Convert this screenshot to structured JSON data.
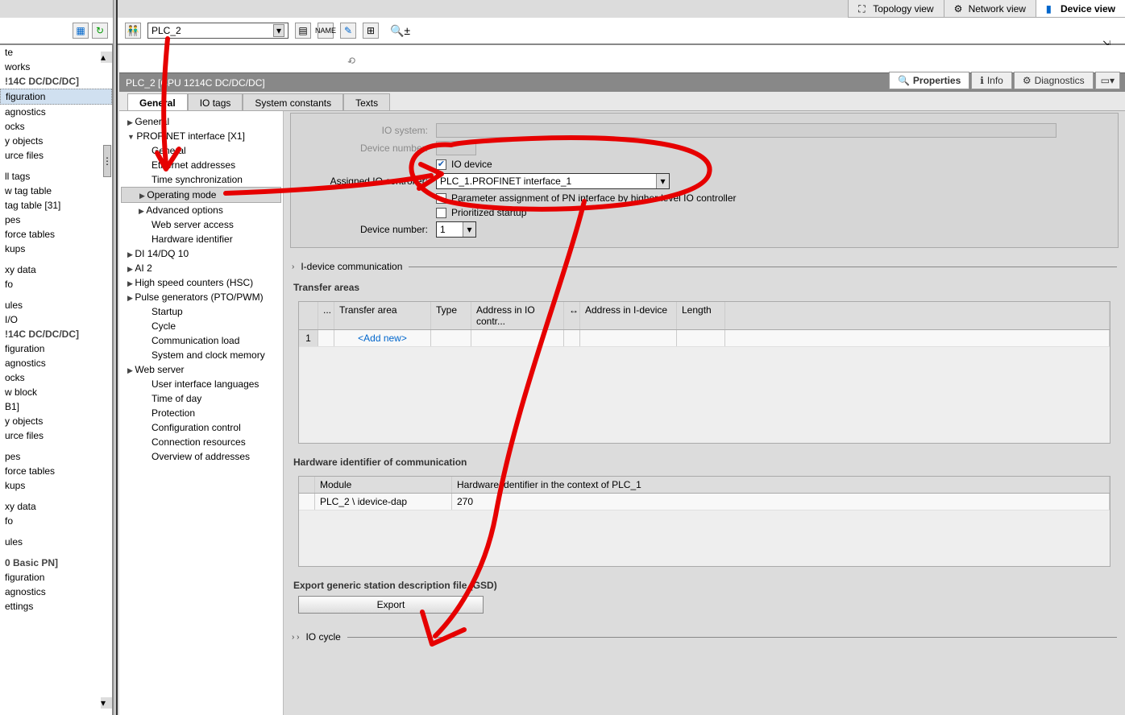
{
  "top_tabs": {
    "topology": "Topology view",
    "network": "Network view",
    "device": "Device view"
  },
  "toolbar": {
    "device_selected": "PLC_2"
  },
  "titlebar": "PLC_2 [CPU 1214C DC/DC/DC]",
  "info_tabs": {
    "properties": "Properties",
    "info": "Info",
    "diagnostics": "Diagnostics"
  },
  "prop_tabs": {
    "general": "General",
    "io_tags": "IO tags",
    "sysconst": "System constants",
    "texts": "Texts"
  },
  "left_items": [
    "te",
    "works",
    "!14C DC/DC/DC]",
    "figuration",
    "agnostics",
    "ocks",
    "y objects",
    "urce files",
    "",
    "ll tags",
    "w tag table",
    "tag table [31]",
    "pes",
    "force tables",
    "kups",
    "",
    "xy data",
    "fo",
    "",
    "ules",
    "I/O",
    "!14C DC/DC/DC]",
    "figuration",
    "agnostics",
    "ocks",
    "w block",
    "B1]",
    "y objects",
    "urce files",
    "",
    "pes",
    "force tables",
    "kups",
    "",
    "xy data",
    "fo",
    "",
    "ules",
    "",
    "0 Basic PN]",
    "figuration",
    "agnostics",
    "ettings"
  ],
  "left_selected_index": 3,
  "left_bold_heads": [
    2,
    21,
    39
  ],
  "tree": [
    {
      "l": 1,
      "t": "General",
      "open": false
    },
    {
      "l": 1,
      "t": "PROFINET interface [X1]",
      "open": true
    },
    {
      "l": 3,
      "t": "General"
    },
    {
      "l": 3,
      "t": "Ethernet addresses"
    },
    {
      "l": 3,
      "t": "Time synchronization"
    },
    {
      "l": 2,
      "t": "Operating mode",
      "sel": true,
      "exp": true
    },
    {
      "l": 2,
      "t": "Advanced options",
      "exp": true
    },
    {
      "l": 3,
      "t": "Web server access"
    },
    {
      "l": 3,
      "t": "Hardware identifier"
    },
    {
      "l": 1,
      "t": "DI 14/DQ 10"
    },
    {
      "l": 1,
      "t": "AI 2"
    },
    {
      "l": 1,
      "t": "High speed counters (HSC)"
    },
    {
      "l": 1,
      "t": "Pulse generators (PTO/PWM)"
    },
    {
      "l": 3,
      "t": "Startup"
    },
    {
      "l": 3,
      "t": "Cycle"
    },
    {
      "l": 3,
      "t": "Communication load"
    },
    {
      "l": 3,
      "t": "System and clock memory"
    },
    {
      "l": 1,
      "t": "Web server"
    },
    {
      "l": 3,
      "t": "User interface languages"
    },
    {
      "l": 3,
      "t": "Time of day"
    },
    {
      "l": 3,
      "t": "Protection"
    },
    {
      "l": 3,
      "t": "Configuration control"
    },
    {
      "l": 3,
      "t": "Connection resources"
    },
    {
      "l": 3,
      "t": "Overview of addresses"
    }
  ],
  "form": {
    "io_system": "IO system:",
    "device_number": "Device number:",
    "io_device": "IO device",
    "assigned": "Assigned IO controller:",
    "assigned_value": "PLC_1.PROFINET interface_1",
    "param_assign": "Parameter assignment of PN interface by higher-level IO controller",
    "prioritized": "Prioritized startup",
    "devnum2": "Device number:",
    "devnum2_val": "1"
  },
  "sections": {
    "idev": "I-device communication",
    "transfer": "Transfer areas",
    "hwid": "Hardware identifier of communication",
    "export": "Export generic station description file (GSD)",
    "iocycle": "IO cycle",
    "export_btn": "Export"
  },
  "transfer_cols": {
    "dots": "...",
    "area": "Transfer area",
    "type": "Type",
    "addr_ctrl": "Address in IO contr...",
    "swap": "↔",
    "addr_idev": "Address in I-device",
    "length": "Length"
  },
  "transfer_addnew": "<Add new>",
  "hw_cols": {
    "module": "Module",
    "hwid": "Hardware identifier in the context of PLC_1"
  },
  "hw_row": {
    "module": "PLC_2 \\ idevice-dap",
    "hwid": "270"
  }
}
